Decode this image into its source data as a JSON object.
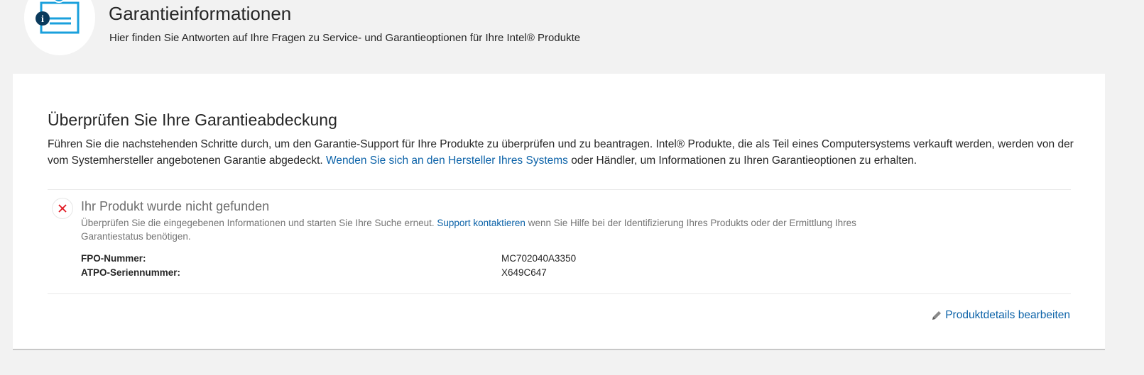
{
  "header": {
    "icon": "warranty-certificate-icon",
    "title": "Garantieinformationen",
    "subtitle": "Hier finden Sie Antworten auf Ihre Fragen zu Service- und Garantieoptionen für Ihre Intel® Produkte"
  },
  "card": {
    "title": "Überprüfen Sie Ihre Garantieabdeckung",
    "intro_text_1": "Führen Sie die nachstehenden Schritte durch, um den Garantie-Support für Ihre Produkte zu überprüfen und zu beantragen. Intel® Produkte, die als Teil eines Computersystems verkauft werden, werden von der vom Systemhersteller angebotenen Garantie abgedeckt. ",
    "intro_link": "Wenden Sie sich an den Hersteller Ihres Systems",
    "intro_text_2": " oder Händler, um Informationen zu Ihren Garantieoptionen zu erhalten."
  },
  "result": {
    "status_icon": "close-icon",
    "status_color": "#e0141e",
    "title": "Ihr Produkt wurde nicht gefunden",
    "text_1": "Überprüfen Sie die eingegebenen Informationen und starten Sie Ihre Suche erneut. ",
    "support_link": "Support kontaktieren",
    "text_2": " wenn Sie Hilfe bei der Identifizierung Ihres Produkts oder der Ermittlung Ihres Garantiestatus benötigen.",
    "details": [
      {
        "label": "FPO-Nummer:",
        "value": "MC702040A3350"
      },
      {
        "label": "ATPO-Seriennummer:",
        "value": "X649C647"
      }
    ]
  },
  "actions": {
    "edit_icon": "pencil-icon",
    "edit_label": "Produktdetails bearbeiten"
  },
  "colors": {
    "link": "#0b62a8",
    "icon_blue": "#1aa0dc",
    "icon_dark": "#0a3a5c"
  }
}
